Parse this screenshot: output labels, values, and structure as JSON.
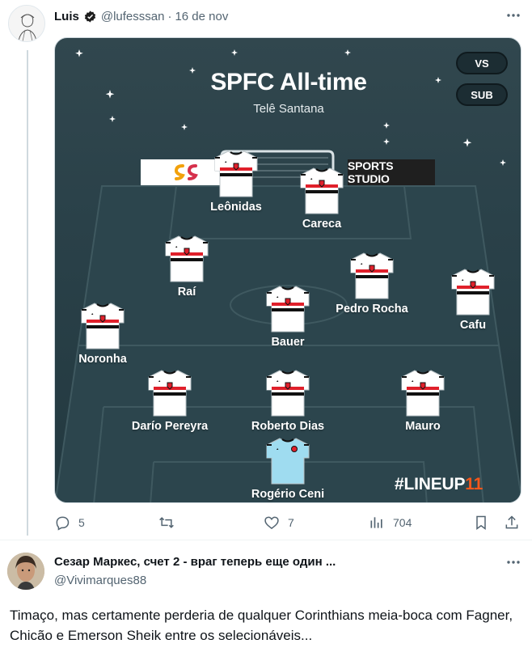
{
  "tweet": {
    "author_name": "Luis",
    "handle": "@lufesssan",
    "separator": "·",
    "date": "16 de nov",
    "stats": {
      "replies": "5",
      "retweets": "",
      "likes": "7",
      "views": "704"
    }
  },
  "lineup_image": {
    "title": "SPFC All-time",
    "subtitle": "Telê Santana",
    "vs_label": "VS",
    "sub_label": "SUB",
    "sponsor_text": "SPORTS STUDIO",
    "brand_hash": "#LINEUP",
    "brand_number": "11",
    "players": [
      {
        "name": "Leônidas"
      },
      {
        "name": "Careca"
      },
      {
        "name": "Raí"
      },
      {
        "name": "Pedro Rocha"
      },
      {
        "name": "Cafu"
      },
      {
        "name": "Noronha"
      },
      {
        "name": "Bauer"
      },
      {
        "name": "Darío Pereyra"
      },
      {
        "name": "Roberto Dias"
      },
      {
        "name": "Mauro"
      },
      {
        "name": "Rogério Ceni"
      }
    ],
    "colors": {
      "pitch": "#2a4149",
      "shirt_white": "#ffffff",
      "shirt_red": "#e0202b",
      "shirt_black": "#111111",
      "keeper_shirt": "#9fdcf0",
      "brand_accent": "#f4571b"
    }
  },
  "reply": {
    "author_name": "Сезар Маркес, счет 2 - враг теперь еще один ...",
    "handle": "@Vivimarques88",
    "text": "Timaço, mas certamente perderia de qualquer Corinthians meia-boca com Fagner, Chicão e Emerson Sheik entre os selecionáveis..."
  },
  "icons": [
    "verified-badge-icon",
    "more-options-icon",
    "reply-icon",
    "retweet-icon",
    "like-icon",
    "views-icon",
    "bookmark-icon",
    "share-icon"
  ]
}
